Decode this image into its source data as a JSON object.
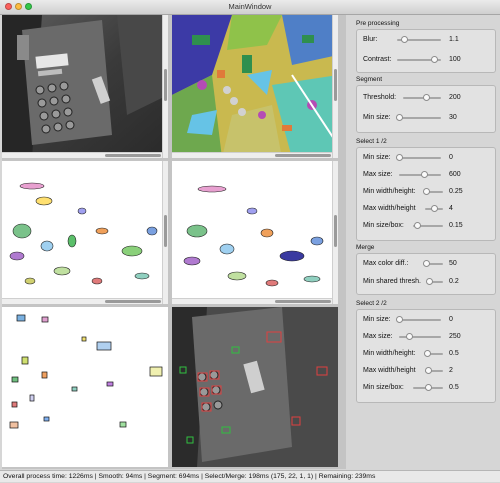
{
  "window": {
    "title": "MainWindow"
  },
  "colors": {
    "close": "#fc605c",
    "minimize": "#fdbc40",
    "zoom": "#34c84a"
  },
  "panel": {
    "preprocessing": {
      "title": "Pre processing",
      "sliders": [
        {
          "label": "Blur:",
          "value": "1.1",
          "level": 0.16
        },
        {
          "label": "Contrast:",
          "value": "100",
          "level": 0.85
        }
      ]
    },
    "segment": {
      "title": "Segment",
      "sliders": [
        {
          "label": "Threshold:",
          "value": "200",
          "level": 0.62
        },
        {
          "label": "Min size:",
          "value": "30",
          "level": 0.02
        }
      ]
    },
    "select1": {
      "title": "Select 1 /2",
      "sliders": [
        {
          "label": "Min size:",
          "value": "0",
          "level": 0.0
        },
        {
          "label": "Max size:",
          "value": "600",
          "level": 0.6
        },
        {
          "label": "Min width/height:",
          "value": "0.25",
          "level": 0.06
        },
        {
          "label": "Max width/height",
          "value": "4",
          "level": 0.55
        },
        {
          "label": "Min size/box:",
          "value": "0.15",
          "level": 0.16
        }
      ]
    },
    "merge": {
      "title": "Merge",
      "sliders": [
        {
          "label": "Max color diff.:",
          "value": "50",
          "level": 0.17
        },
        {
          "label": "Min shared thresh.",
          "value": "0.2",
          "level": 0.05
        }
      ]
    },
    "select2": {
      "title": "Select 2 /2",
      "sliders": [
        {
          "label": "Min size:",
          "value": "0",
          "level": 0.0
        },
        {
          "label": "Max size:",
          "value": "250",
          "level": 0.25
        },
        {
          "label": "Min width/height:",
          "value": "0.5",
          "level": 0.13
        },
        {
          "label": "Max width/height",
          "value": "2",
          "level": 0.2
        },
        {
          "label": "Min size/box:",
          "value": "0.5",
          "level": 0.5
        }
      ]
    }
  },
  "status": {
    "text": "Overall process time: 1226ms | Smooth: 94ms | Segment: 694ms | Select/Merge: 198ms (175, 22, 1, 1) | Remaining: 239ms"
  }
}
